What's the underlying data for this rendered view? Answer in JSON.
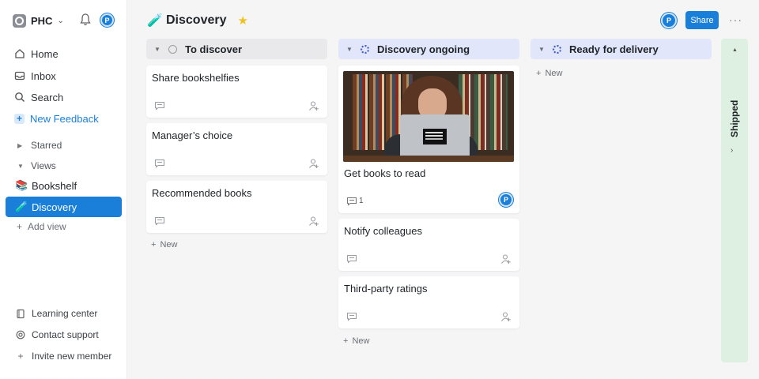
{
  "sidebar": {
    "workspace": "PHC",
    "avatar_initial": "P",
    "nav": [
      {
        "label": "Home",
        "icon": "home-icon"
      },
      {
        "label": "Inbox",
        "icon": "inbox-icon"
      },
      {
        "label": "Search",
        "icon": "search-icon"
      },
      {
        "label": "New Feedback",
        "icon": "plus-icon"
      }
    ],
    "sections": {
      "starred": "Starred",
      "views": "Views"
    },
    "views": [
      {
        "label": "Bookshelf",
        "emoji": "📚"
      },
      {
        "label": "Discovery",
        "emoji": "🧪"
      }
    ],
    "add_view": "Add view",
    "footer": [
      {
        "label": "Learning center",
        "icon": "book-icon"
      },
      {
        "label": "Contact support",
        "icon": "support-icon"
      },
      {
        "label": "Invite new member",
        "icon": "plus-icon"
      }
    ]
  },
  "header": {
    "emoji": "🧪",
    "title": "Discovery",
    "star": "★",
    "avatar_initial": "P",
    "share_label": "Share",
    "more": "···"
  },
  "columns": [
    {
      "title": "To discover",
      "cards": [
        {
          "title": "Share bookshelfies"
        },
        {
          "title": "Manager’s choice"
        },
        {
          "title": "Recommended books"
        }
      ],
      "new_label": "New"
    },
    {
      "title": "Discovery ongoing",
      "cards": [
        {
          "title": "Get books to read",
          "comments": "1",
          "avatar_initial": "P"
        },
        {
          "title": "Notify colleagues"
        },
        {
          "title": "Third-party ratings"
        }
      ],
      "new_label": "New"
    },
    {
      "title": "Ready for delivery",
      "cards": [],
      "new_label": "New"
    }
  ],
  "collapsed_column": {
    "title": "Shipped"
  },
  "colors": {
    "accent": "#1a7fd9",
    "shipped_bg": "#def0e1",
    "ongoing_bg": "#e2e6fa",
    "star": "#f1c21b"
  }
}
